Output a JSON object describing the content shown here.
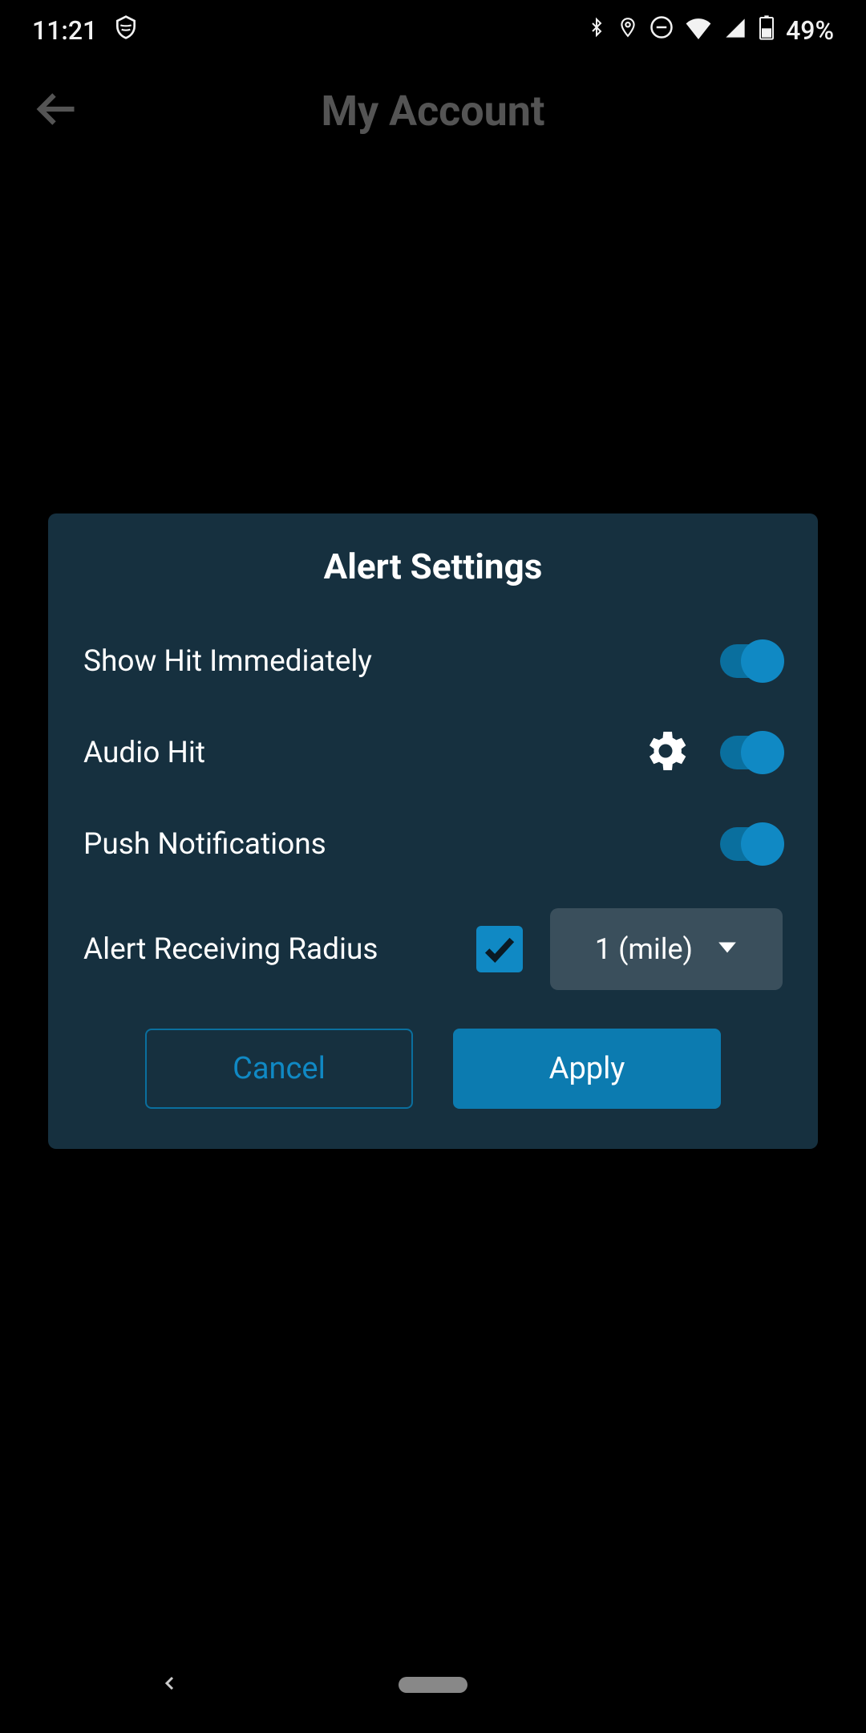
{
  "statusBar": {
    "time": "11:21",
    "battery": "49%"
  },
  "header": {
    "title": "My Account"
  },
  "dialog": {
    "title": "Alert Settings",
    "rows": {
      "showHit": "Show Hit Immediately",
      "audioHit": "Audio Hit",
      "pushNotifications": "Push Notifications",
      "alertRadius": "Alert Receiving Radius"
    },
    "radiusSelect": "1 (mile)",
    "buttons": {
      "cancel": "Cancel",
      "apply": "Apply"
    }
  }
}
